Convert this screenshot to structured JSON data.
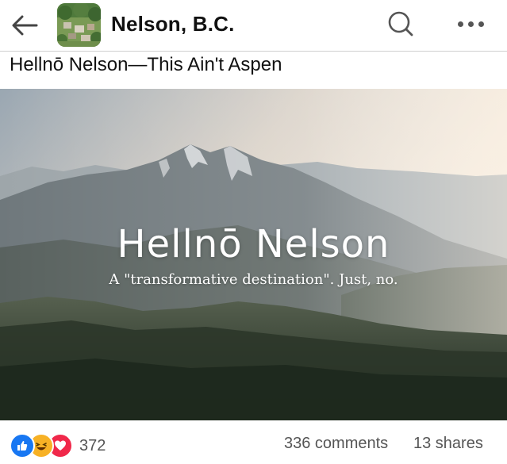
{
  "header": {
    "page_name": "Nelson, B.C.",
    "back_icon": "arrow-left-icon",
    "search_icon": "search-icon",
    "more_icon": "more-options-icon"
  },
  "post": {
    "title": "Hellnō Nelson—This Ain't Aspen",
    "image": {
      "headline": "Hellnō Nelson",
      "subheadline": "A \"transformative destination\". Just, no."
    }
  },
  "engagement": {
    "reactions": [
      "like-icon",
      "haha-icon",
      "love-icon"
    ],
    "reaction_count": "372",
    "comments": "336 comments",
    "shares": "13 shares"
  },
  "colors": {
    "like": "#1877f2",
    "haha": "#f7b125",
    "love": "#f0284a",
    "text_secondary": "#555555"
  }
}
